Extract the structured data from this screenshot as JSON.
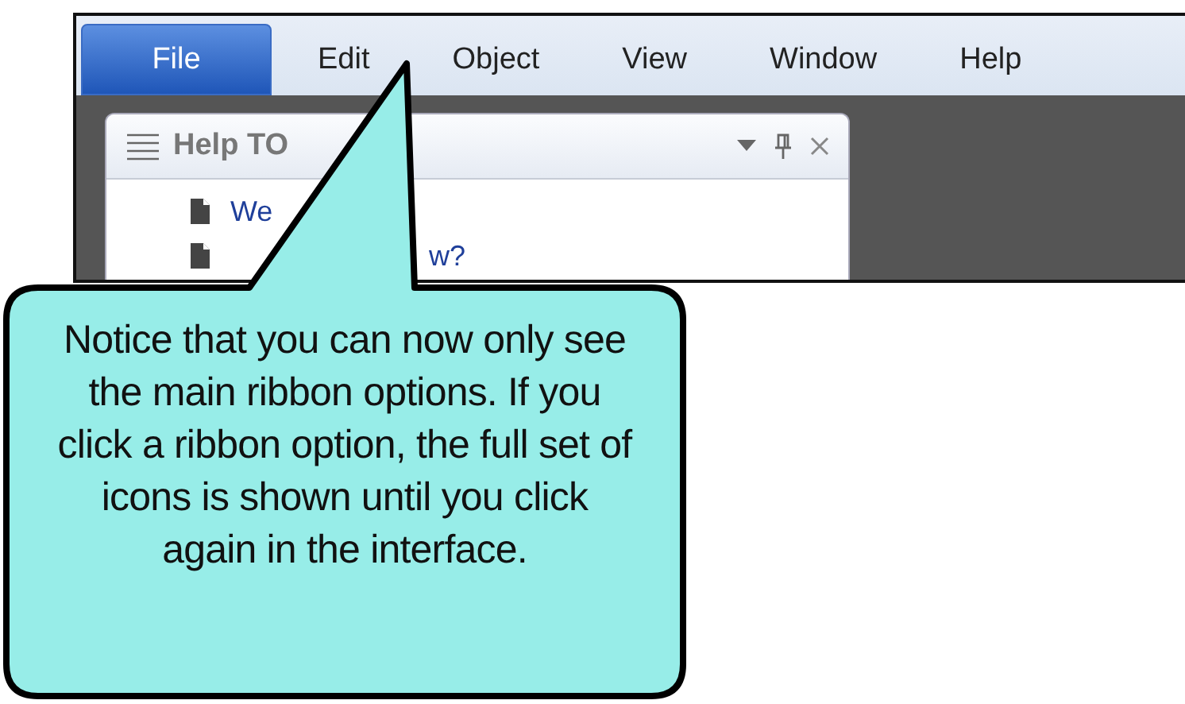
{
  "menu": [
    {
      "label": "File",
      "selected": true
    },
    {
      "label": "Edit",
      "selected": false
    },
    {
      "label": "Object",
      "selected": false
    },
    {
      "label": "View",
      "selected": false
    },
    {
      "label": "Window",
      "selected": false
    },
    {
      "label": "Help",
      "selected": false
    }
  ],
  "panel": {
    "title": "Help TO",
    "items": [
      {
        "text": "We"
      },
      {
        "text": "w?"
      }
    ]
  },
  "callout": {
    "text": "Notice that you can now only see the main ribbon options. If you click a ribbon option, the full set of icons is shown until you click again in the interface."
  }
}
